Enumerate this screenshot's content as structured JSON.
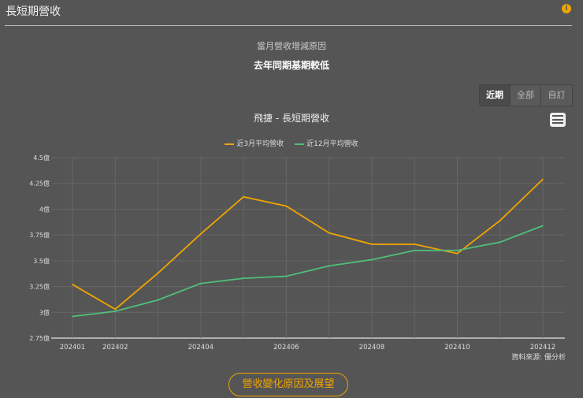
{
  "header": {
    "title": "長短期營收",
    "info_icon": "info-icon"
  },
  "reason": {
    "heading": "當月營收增減原因",
    "text": "去年同期基期較低"
  },
  "tabs": [
    {
      "label": "近期",
      "active": true
    },
    {
      "label": "全部",
      "active": false
    },
    {
      "label": "自訂",
      "active": false
    }
  ],
  "source": "資料來源: 優分析",
  "footer_button": "營收變化原因及展望",
  "chart_data": {
    "type": "line",
    "title": "飛捷 - 長短期營收",
    "x": [
      "202401",
      "202402",
      "202403",
      "202404",
      "202405",
      "202406",
      "202407",
      "202408",
      "202409",
      "202410",
      "202411",
      "202412"
    ],
    "xtick_labels": [
      "202401",
      "202402",
      "",
      "202404",
      "",
      "202406",
      "",
      "202408",
      "",
      "202410",
      "",
      "202412"
    ],
    "ylim": [
      2.75,
      4.5
    ],
    "yticks": [
      2.75,
      3,
      3.25,
      3.5,
      3.75,
      4,
      4.25,
      4.5
    ],
    "ytick_labels": [
      "2.75億",
      "3億",
      "3.25億",
      "3.5億",
      "3.75億",
      "4億",
      "4.25億",
      "4.5億"
    ],
    "ylabel": "",
    "xlabel": "",
    "grid": true,
    "legend": "top-center",
    "series": [
      {
        "name": "近3月平均營收",
        "color": "#f0a500",
        "values": [
          3.27,
          3.03,
          3.38,
          3.76,
          4.12,
          4.03,
          3.77,
          3.66,
          3.66,
          3.57,
          3.89,
          4.29
        ]
      },
      {
        "name": "近12月平均營收",
        "color": "#4fbf7a",
        "values": [
          2.96,
          3.01,
          3.12,
          3.28,
          3.33,
          3.35,
          3.45,
          3.51,
          3.6,
          3.6,
          3.68,
          3.84
        ]
      }
    ]
  }
}
